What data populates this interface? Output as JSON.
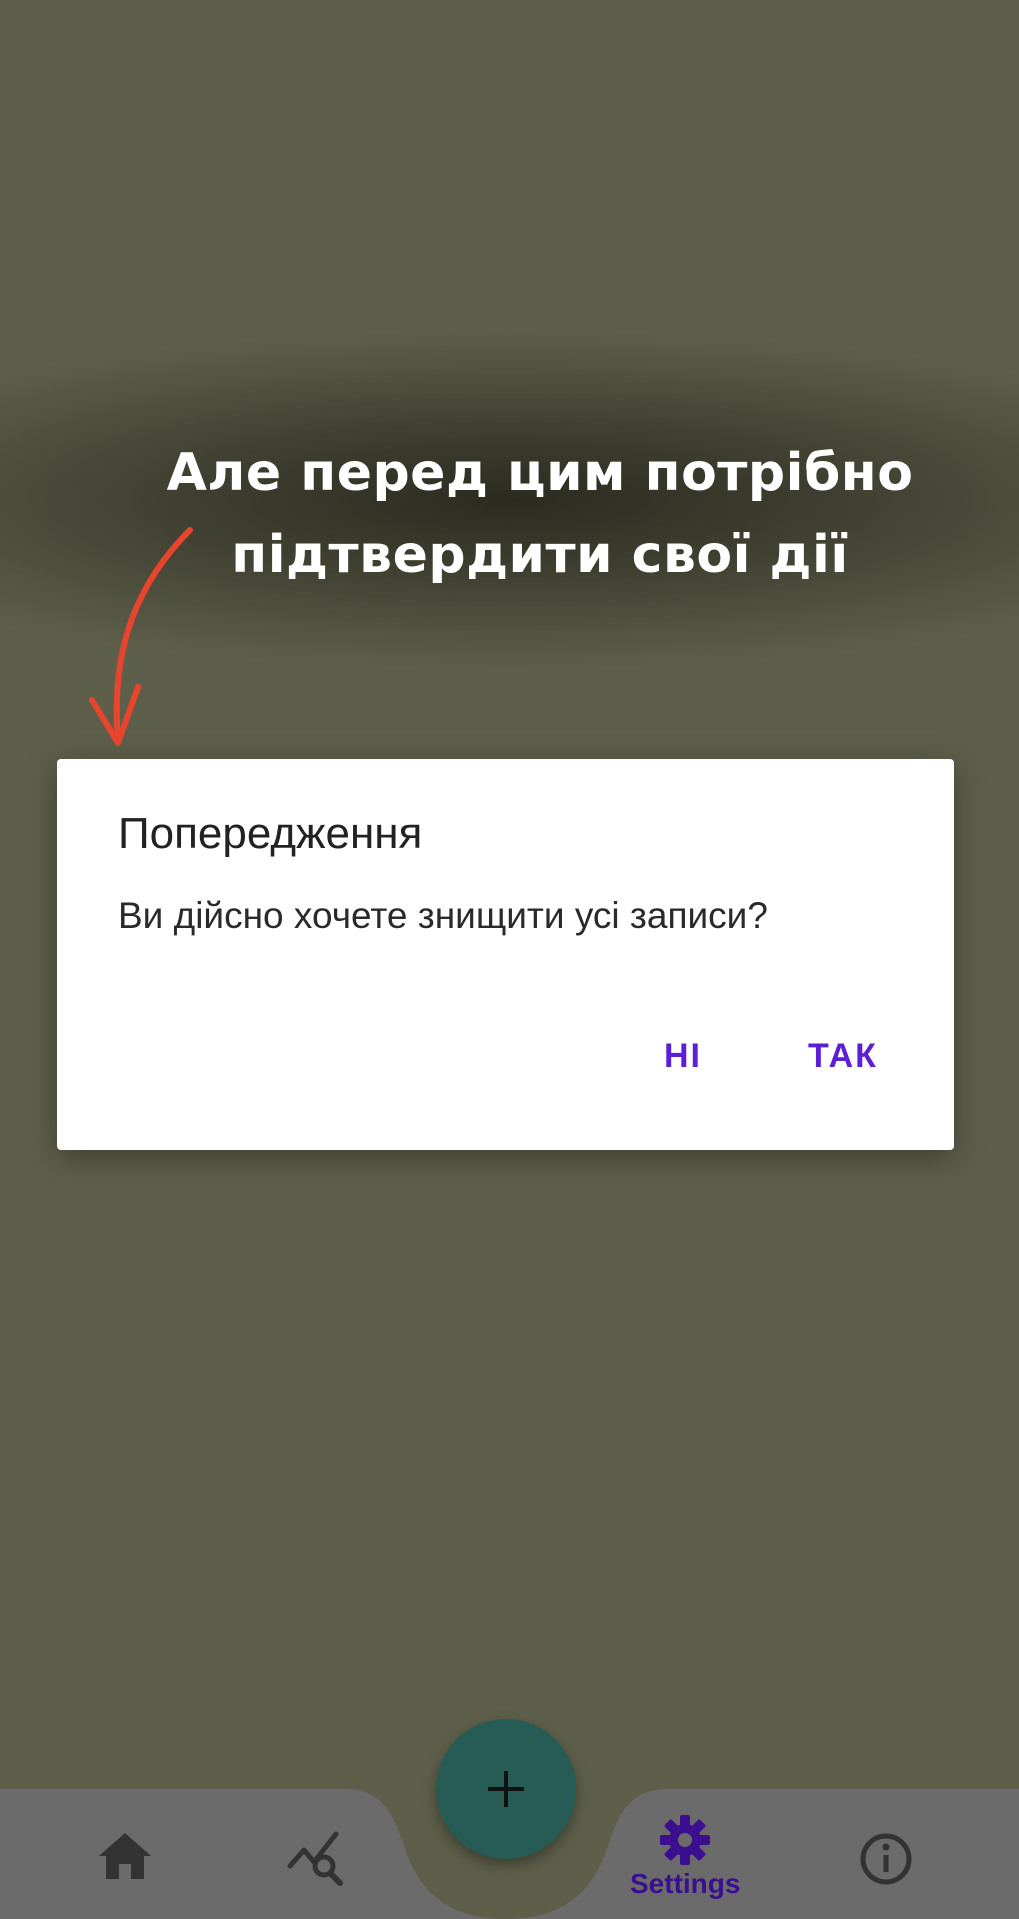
{
  "overlay": {
    "headline_line1": "Але перед цим потрібно",
    "headline_line2": "підтвердити свої дії"
  },
  "dialog": {
    "title": "Попередження",
    "message": "Ви дійсно хочете знищити усі записи?",
    "no_label": "НІ",
    "yes_label": "ТАК"
  },
  "bottom_nav": {
    "fab_icon": "plus-icon",
    "items": [
      {
        "icon": "home-icon",
        "label": ""
      },
      {
        "icon": "chart-search-icon",
        "label": ""
      },
      {
        "icon": "gear-icon",
        "label": "Settings",
        "active": true
      },
      {
        "icon": "info-icon",
        "label": ""
      }
    ]
  },
  "colors": {
    "background": "#5e5f4a",
    "accent": "#5a1fd6",
    "fab": "#265c55",
    "nav_bar": "#6b6b6b",
    "arrow": "#e8452f"
  }
}
